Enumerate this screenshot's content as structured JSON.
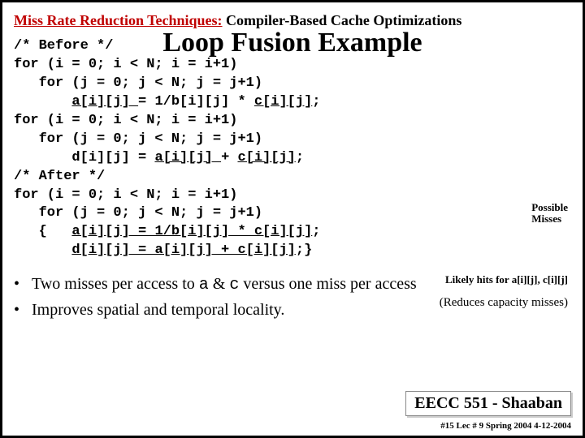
{
  "heading": {
    "red": "Miss Rate Reduction Techniques:",
    "rest": " Compiler-Based Cache Optimizations"
  },
  "title": "Loop Fusion Example",
  "code": {
    "l1": "/* Before */",
    "l2": "for (i = 0; i < N; i = i+1)",
    "l3": "   for (j = 0; j < N; j = j+1)",
    "l4a": "       ",
    "l4b": "a[i][j] ",
    "l4c": "= 1/b[i][j] * ",
    "l4d": "c[i][j]",
    "l4e": ";",
    "l5": "for (i = 0; i < N; i = i+1)",
    "l6": "   for (j = 0; j < N; j = j+1)",
    "l7a": "       d[i][j] = ",
    "l7b": "a[i][j] ",
    "l7c": "+ ",
    "l7d": "c[i][j]",
    "l7e": ";",
    "l8": "/* After */",
    "l9": "for (i = 0; i < N; i = i+1)",
    "l10": "   for (j = 0; j < N; j = j+1)",
    "l11a": "   {   ",
    "l11b": "a[i][j] = 1/b[i][j] * c[i][j]",
    "l11c": ";",
    "l12a": "       ",
    "l12b": "d[i][j] = a[i][j] + c[i][j]",
    "l12c": ";}"
  },
  "notes": {
    "possible": "Possible\nMisses",
    "likely": "Likely hits for  a[i][j],  c[i][j]",
    "reduces": "(Reduces capacity misses)"
  },
  "bullets": {
    "b1a": "Two misses per access to ",
    "b1b": "a",
    "b1c": " & ",
    "b1d": "c",
    "b1e": " versus one miss per access",
    "b2": "Improves spatial and temporal locality."
  },
  "footer": "EECC 551 - Shaaban",
  "footer2": "#15   Lec # 9  Spring 2004    4-12-2004"
}
